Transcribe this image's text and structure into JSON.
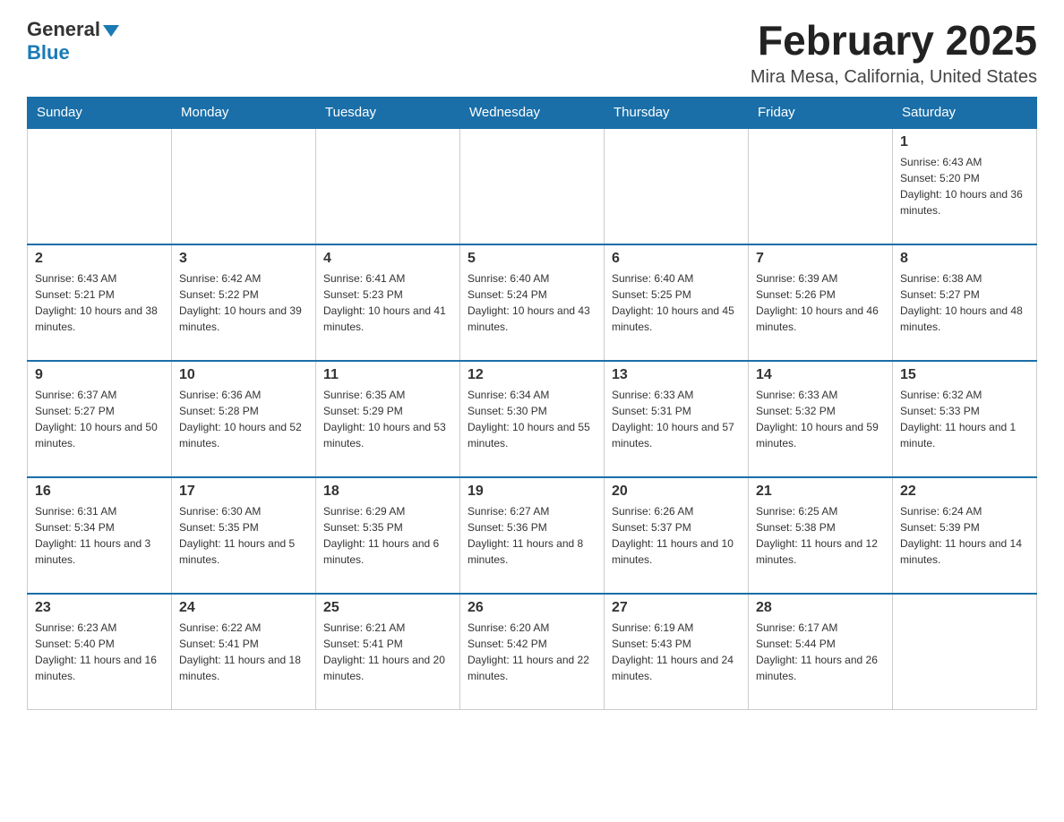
{
  "header": {
    "logo_general": "General",
    "logo_blue": "Blue",
    "month_title": "February 2025",
    "location": "Mira Mesa, California, United States"
  },
  "days_of_week": [
    "Sunday",
    "Monday",
    "Tuesday",
    "Wednesday",
    "Thursday",
    "Friday",
    "Saturday"
  ],
  "weeks": [
    [
      {
        "day": "",
        "info": ""
      },
      {
        "day": "",
        "info": ""
      },
      {
        "day": "",
        "info": ""
      },
      {
        "day": "",
        "info": ""
      },
      {
        "day": "",
        "info": ""
      },
      {
        "day": "",
        "info": ""
      },
      {
        "day": "1",
        "info": "Sunrise: 6:43 AM\nSunset: 5:20 PM\nDaylight: 10 hours and 36 minutes."
      }
    ],
    [
      {
        "day": "2",
        "info": "Sunrise: 6:43 AM\nSunset: 5:21 PM\nDaylight: 10 hours and 38 minutes."
      },
      {
        "day": "3",
        "info": "Sunrise: 6:42 AM\nSunset: 5:22 PM\nDaylight: 10 hours and 39 minutes."
      },
      {
        "day": "4",
        "info": "Sunrise: 6:41 AM\nSunset: 5:23 PM\nDaylight: 10 hours and 41 minutes."
      },
      {
        "day": "5",
        "info": "Sunrise: 6:40 AM\nSunset: 5:24 PM\nDaylight: 10 hours and 43 minutes."
      },
      {
        "day": "6",
        "info": "Sunrise: 6:40 AM\nSunset: 5:25 PM\nDaylight: 10 hours and 45 minutes."
      },
      {
        "day": "7",
        "info": "Sunrise: 6:39 AM\nSunset: 5:26 PM\nDaylight: 10 hours and 46 minutes."
      },
      {
        "day": "8",
        "info": "Sunrise: 6:38 AM\nSunset: 5:27 PM\nDaylight: 10 hours and 48 minutes."
      }
    ],
    [
      {
        "day": "9",
        "info": "Sunrise: 6:37 AM\nSunset: 5:27 PM\nDaylight: 10 hours and 50 minutes."
      },
      {
        "day": "10",
        "info": "Sunrise: 6:36 AM\nSunset: 5:28 PM\nDaylight: 10 hours and 52 minutes."
      },
      {
        "day": "11",
        "info": "Sunrise: 6:35 AM\nSunset: 5:29 PM\nDaylight: 10 hours and 53 minutes."
      },
      {
        "day": "12",
        "info": "Sunrise: 6:34 AM\nSunset: 5:30 PM\nDaylight: 10 hours and 55 minutes."
      },
      {
        "day": "13",
        "info": "Sunrise: 6:33 AM\nSunset: 5:31 PM\nDaylight: 10 hours and 57 minutes."
      },
      {
        "day": "14",
        "info": "Sunrise: 6:33 AM\nSunset: 5:32 PM\nDaylight: 10 hours and 59 minutes."
      },
      {
        "day": "15",
        "info": "Sunrise: 6:32 AM\nSunset: 5:33 PM\nDaylight: 11 hours and 1 minute."
      }
    ],
    [
      {
        "day": "16",
        "info": "Sunrise: 6:31 AM\nSunset: 5:34 PM\nDaylight: 11 hours and 3 minutes."
      },
      {
        "day": "17",
        "info": "Sunrise: 6:30 AM\nSunset: 5:35 PM\nDaylight: 11 hours and 5 minutes."
      },
      {
        "day": "18",
        "info": "Sunrise: 6:29 AM\nSunset: 5:35 PM\nDaylight: 11 hours and 6 minutes."
      },
      {
        "day": "19",
        "info": "Sunrise: 6:27 AM\nSunset: 5:36 PM\nDaylight: 11 hours and 8 minutes."
      },
      {
        "day": "20",
        "info": "Sunrise: 6:26 AM\nSunset: 5:37 PM\nDaylight: 11 hours and 10 minutes."
      },
      {
        "day": "21",
        "info": "Sunrise: 6:25 AM\nSunset: 5:38 PM\nDaylight: 11 hours and 12 minutes."
      },
      {
        "day": "22",
        "info": "Sunrise: 6:24 AM\nSunset: 5:39 PM\nDaylight: 11 hours and 14 minutes."
      }
    ],
    [
      {
        "day": "23",
        "info": "Sunrise: 6:23 AM\nSunset: 5:40 PM\nDaylight: 11 hours and 16 minutes."
      },
      {
        "day": "24",
        "info": "Sunrise: 6:22 AM\nSunset: 5:41 PM\nDaylight: 11 hours and 18 minutes."
      },
      {
        "day": "25",
        "info": "Sunrise: 6:21 AM\nSunset: 5:41 PM\nDaylight: 11 hours and 20 minutes."
      },
      {
        "day": "26",
        "info": "Sunrise: 6:20 AM\nSunset: 5:42 PM\nDaylight: 11 hours and 22 minutes."
      },
      {
        "day": "27",
        "info": "Sunrise: 6:19 AM\nSunset: 5:43 PM\nDaylight: 11 hours and 24 minutes."
      },
      {
        "day": "28",
        "info": "Sunrise: 6:17 AM\nSunset: 5:44 PM\nDaylight: 11 hours and 26 minutes."
      },
      {
        "day": "",
        "info": ""
      }
    ]
  ]
}
